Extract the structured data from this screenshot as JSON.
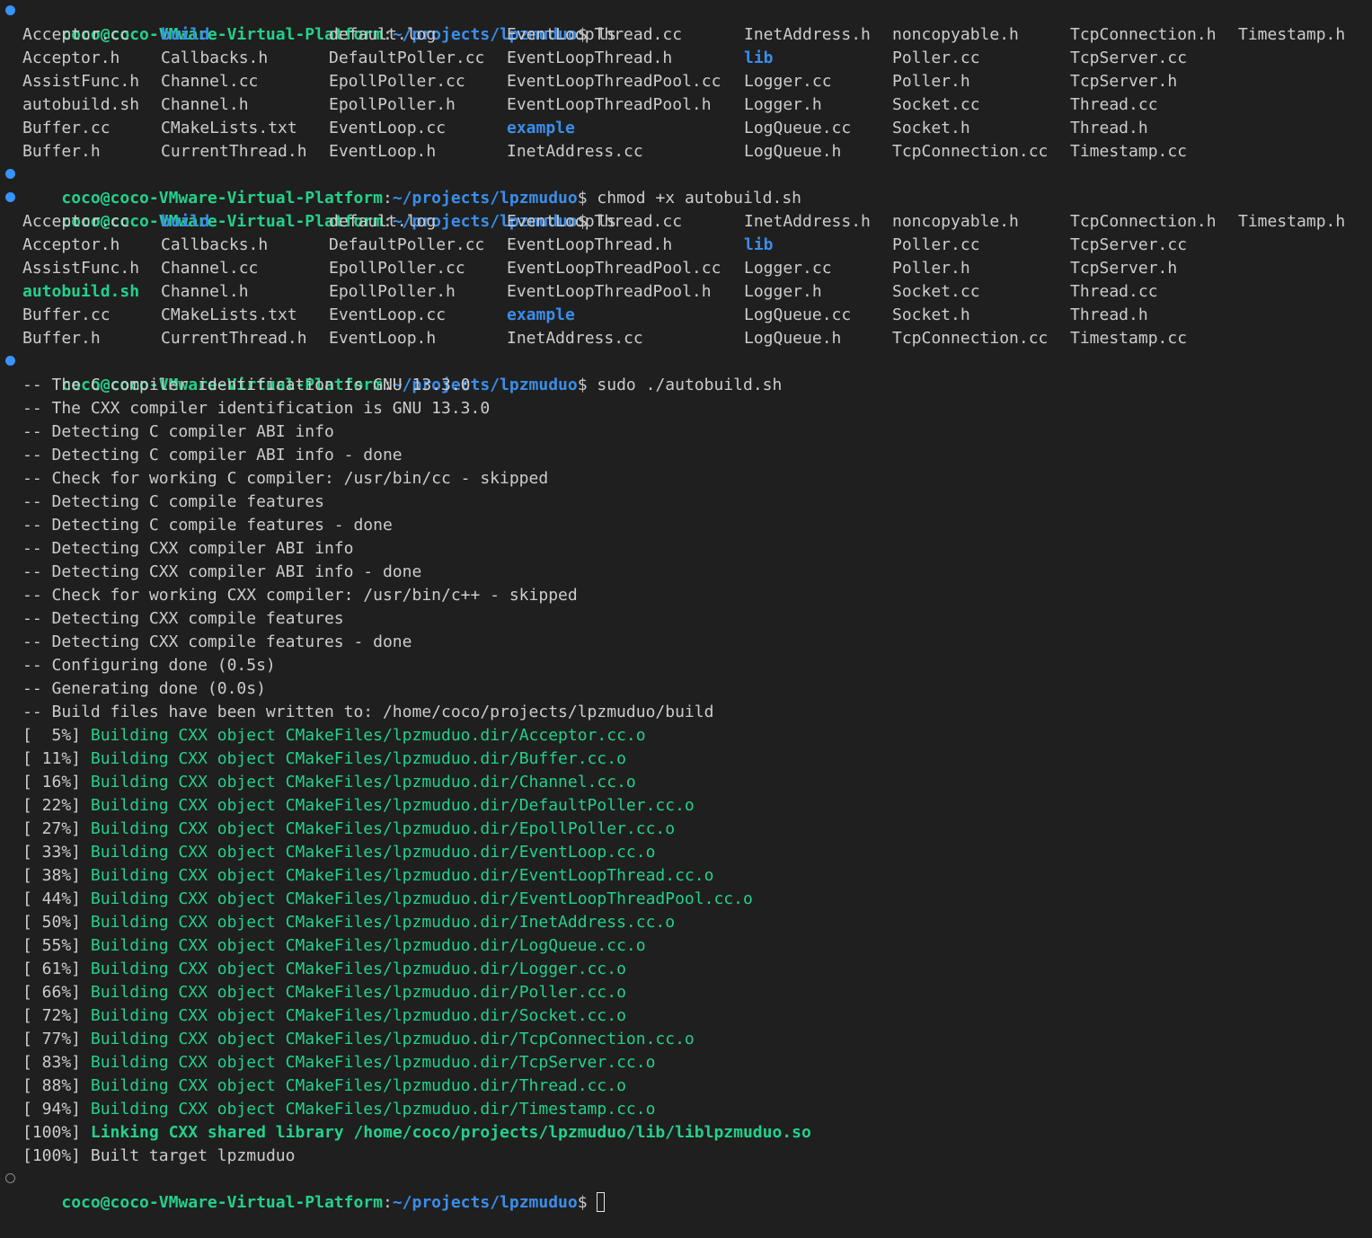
{
  "prompt": {
    "user_host": "coco@coco-VMware-Virtual-Platform",
    "colon": ":",
    "path": "~/projects/lpzmuduo",
    "symbol": "$"
  },
  "commands": {
    "ls1": "ls",
    "chmod": "chmod +x autobuild.sh",
    "ls2": "ls",
    "build": "sudo ./autobuild.sh",
    "final": ""
  },
  "ls_before": [
    [
      {
        "name": "Acceptor.cc",
        "type": "file"
      },
      {
        "name": "build",
        "type": "dir"
      },
      {
        "name": "default.log",
        "type": "file"
      },
      {
        "name": "EventLoopThread.cc",
        "type": "file"
      },
      {
        "name": "InetAddress.h",
        "type": "file"
      },
      {
        "name": "noncopyable.h",
        "type": "file"
      },
      {
        "name": "TcpConnection.h",
        "type": "file"
      },
      {
        "name": "Timestamp.h",
        "type": "file"
      }
    ],
    [
      {
        "name": "Acceptor.h",
        "type": "file"
      },
      {
        "name": "Callbacks.h",
        "type": "file"
      },
      {
        "name": "DefaultPoller.cc",
        "type": "file"
      },
      {
        "name": "EventLoopThread.h",
        "type": "file"
      },
      {
        "name": "lib",
        "type": "dir"
      },
      {
        "name": "Poller.cc",
        "type": "file"
      },
      {
        "name": "TcpServer.cc",
        "type": "file"
      }
    ],
    [
      {
        "name": "AssistFunc.h",
        "type": "file"
      },
      {
        "name": "Channel.cc",
        "type": "file"
      },
      {
        "name": "EpollPoller.cc",
        "type": "file"
      },
      {
        "name": "EventLoopThreadPool.cc",
        "type": "file"
      },
      {
        "name": "Logger.cc",
        "type": "file"
      },
      {
        "name": "Poller.h",
        "type": "file"
      },
      {
        "name": "TcpServer.h",
        "type": "file"
      }
    ],
    [
      {
        "name": "autobuild.sh",
        "type": "file"
      },
      {
        "name": "Channel.h",
        "type": "file"
      },
      {
        "name": "EpollPoller.h",
        "type": "file"
      },
      {
        "name": "EventLoopThreadPool.h",
        "type": "file"
      },
      {
        "name": "Logger.h",
        "type": "file"
      },
      {
        "name": "Socket.cc",
        "type": "file"
      },
      {
        "name": "Thread.cc",
        "type": "file"
      }
    ],
    [
      {
        "name": "Buffer.cc",
        "type": "file"
      },
      {
        "name": "CMakeLists.txt",
        "type": "file"
      },
      {
        "name": "EventLoop.cc",
        "type": "file"
      },
      {
        "name": "example",
        "type": "dir"
      },
      {
        "name": "LogQueue.cc",
        "type": "file"
      },
      {
        "name": "Socket.h",
        "type": "file"
      },
      {
        "name": "Thread.h",
        "type": "file"
      }
    ],
    [
      {
        "name": "Buffer.h",
        "type": "file"
      },
      {
        "name": "CurrentThread.h",
        "type": "file"
      },
      {
        "name": "EventLoop.h",
        "type": "file"
      },
      {
        "name": "InetAddress.cc",
        "type": "file"
      },
      {
        "name": "LogQueue.h",
        "type": "file"
      },
      {
        "name": "TcpConnection.cc",
        "type": "file"
      },
      {
        "name": "Timestamp.cc",
        "type": "file"
      }
    ]
  ],
  "ls_after": [
    [
      {
        "name": "Acceptor.cc",
        "type": "file"
      },
      {
        "name": "build",
        "type": "dir"
      },
      {
        "name": "default.log",
        "type": "file"
      },
      {
        "name": "EventLoopThread.cc",
        "type": "file"
      },
      {
        "name": "InetAddress.h",
        "type": "file"
      },
      {
        "name": "noncopyable.h",
        "type": "file"
      },
      {
        "name": "TcpConnection.h",
        "type": "file"
      },
      {
        "name": "Timestamp.h",
        "type": "file"
      }
    ],
    [
      {
        "name": "Acceptor.h",
        "type": "file"
      },
      {
        "name": "Callbacks.h",
        "type": "file"
      },
      {
        "name": "DefaultPoller.cc",
        "type": "file"
      },
      {
        "name": "EventLoopThread.h",
        "type": "file"
      },
      {
        "name": "lib",
        "type": "dir"
      },
      {
        "name": "Poller.cc",
        "type": "file"
      },
      {
        "name": "TcpServer.cc",
        "type": "file"
      }
    ],
    [
      {
        "name": "AssistFunc.h",
        "type": "file"
      },
      {
        "name": "Channel.cc",
        "type": "file"
      },
      {
        "name": "EpollPoller.cc",
        "type": "file"
      },
      {
        "name": "EventLoopThreadPool.cc",
        "type": "file"
      },
      {
        "name": "Logger.cc",
        "type": "file"
      },
      {
        "name": "Poller.h",
        "type": "file"
      },
      {
        "name": "TcpServer.h",
        "type": "file"
      }
    ],
    [
      {
        "name": "autobuild.sh",
        "type": "exec"
      },
      {
        "name": "Channel.h",
        "type": "file"
      },
      {
        "name": "EpollPoller.h",
        "type": "file"
      },
      {
        "name": "EventLoopThreadPool.h",
        "type": "file"
      },
      {
        "name": "Logger.h",
        "type": "file"
      },
      {
        "name": "Socket.cc",
        "type": "file"
      },
      {
        "name": "Thread.cc",
        "type": "file"
      }
    ],
    [
      {
        "name": "Buffer.cc",
        "type": "file"
      },
      {
        "name": "CMakeLists.txt",
        "type": "file"
      },
      {
        "name": "EventLoop.cc",
        "type": "file"
      },
      {
        "name": "example",
        "type": "dir"
      },
      {
        "name": "LogQueue.cc",
        "type": "file"
      },
      {
        "name": "Socket.h",
        "type": "file"
      },
      {
        "name": "Thread.h",
        "type": "file"
      }
    ],
    [
      {
        "name": "Buffer.h",
        "type": "file"
      },
      {
        "name": "CurrentThread.h",
        "type": "file"
      },
      {
        "name": "EventLoop.h",
        "type": "file"
      },
      {
        "name": "InetAddress.cc",
        "type": "file"
      },
      {
        "name": "LogQueue.h",
        "type": "file"
      },
      {
        "name": "TcpConnection.cc",
        "type": "file"
      },
      {
        "name": "Timestamp.cc",
        "type": "file"
      }
    ]
  ],
  "cmake_output": [
    "-- The C compiler identification is GNU 13.3.0",
    "-- The CXX compiler identification is GNU 13.3.0",
    "-- Detecting C compiler ABI info",
    "-- Detecting C compiler ABI info - done",
    "-- Check for working C compiler: /usr/bin/cc - skipped",
    "-- Detecting C compile features",
    "-- Detecting C compile features - done",
    "-- Detecting CXX compiler ABI info",
    "-- Detecting CXX compiler ABI info - done",
    "-- Check for working CXX compiler: /usr/bin/c++ - skipped",
    "-- Detecting CXX compile features",
    "-- Detecting CXX compile features - done",
    "-- Configuring done (0.5s)",
    "-- Generating done (0.0s)",
    "-- Build files have been written to: /home/coco/projects/lpzmuduo/build"
  ],
  "build_steps": [
    {
      "pct": "[  5%]",
      "msg": "Building CXX object CMakeFiles/lpzmuduo.dir/Acceptor.cc.o"
    },
    {
      "pct": "[ 11%]",
      "msg": "Building CXX object CMakeFiles/lpzmuduo.dir/Buffer.cc.o"
    },
    {
      "pct": "[ 16%]",
      "msg": "Building CXX object CMakeFiles/lpzmuduo.dir/Channel.cc.o"
    },
    {
      "pct": "[ 22%]",
      "msg": "Building CXX object CMakeFiles/lpzmuduo.dir/DefaultPoller.cc.o"
    },
    {
      "pct": "[ 27%]",
      "msg": "Building CXX object CMakeFiles/lpzmuduo.dir/EpollPoller.cc.o"
    },
    {
      "pct": "[ 33%]",
      "msg": "Building CXX object CMakeFiles/lpzmuduo.dir/EventLoop.cc.o"
    },
    {
      "pct": "[ 38%]",
      "msg": "Building CXX object CMakeFiles/lpzmuduo.dir/EventLoopThread.cc.o"
    },
    {
      "pct": "[ 44%]",
      "msg": "Building CXX object CMakeFiles/lpzmuduo.dir/EventLoopThreadPool.cc.o"
    },
    {
      "pct": "[ 50%]",
      "msg": "Building CXX object CMakeFiles/lpzmuduo.dir/InetAddress.cc.o"
    },
    {
      "pct": "[ 55%]",
      "msg": "Building CXX object CMakeFiles/lpzmuduo.dir/LogQueue.cc.o"
    },
    {
      "pct": "[ 61%]",
      "msg": "Building CXX object CMakeFiles/lpzmuduo.dir/Logger.cc.o"
    },
    {
      "pct": "[ 66%]",
      "msg": "Building CXX object CMakeFiles/lpzmuduo.dir/Poller.cc.o"
    },
    {
      "pct": "[ 72%]",
      "msg": "Building CXX object CMakeFiles/lpzmuduo.dir/Socket.cc.o"
    },
    {
      "pct": "[ 77%]",
      "msg": "Building CXX object CMakeFiles/lpzmuduo.dir/TcpConnection.cc.o"
    },
    {
      "pct": "[ 83%]",
      "msg": "Building CXX object CMakeFiles/lpzmuduo.dir/TcpServer.cc.o"
    },
    {
      "pct": "[ 88%]",
      "msg": "Building CXX object CMakeFiles/lpzmuduo.dir/Thread.cc.o"
    },
    {
      "pct": "[ 94%]",
      "msg": "Building CXX object CMakeFiles/lpzmuduo.dir/Timestamp.cc.o"
    }
  ],
  "link_step": {
    "pct": "[100%]",
    "msg": "Linking CXX shared library /home/coco/projects/lpzmuduo/lib/liblpzmuduo.so"
  },
  "built_target": {
    "pct": "[100%]",
    "msg": "Built target lpzmuduo"
  },
  "colors": {
    "background": "#1f1f1f",
    "foreground": "#cccccc",
    "green": "#23d18b",
    "blue": "#3b8eea",
    "gutter_done": "#3794ff"
  }
}
